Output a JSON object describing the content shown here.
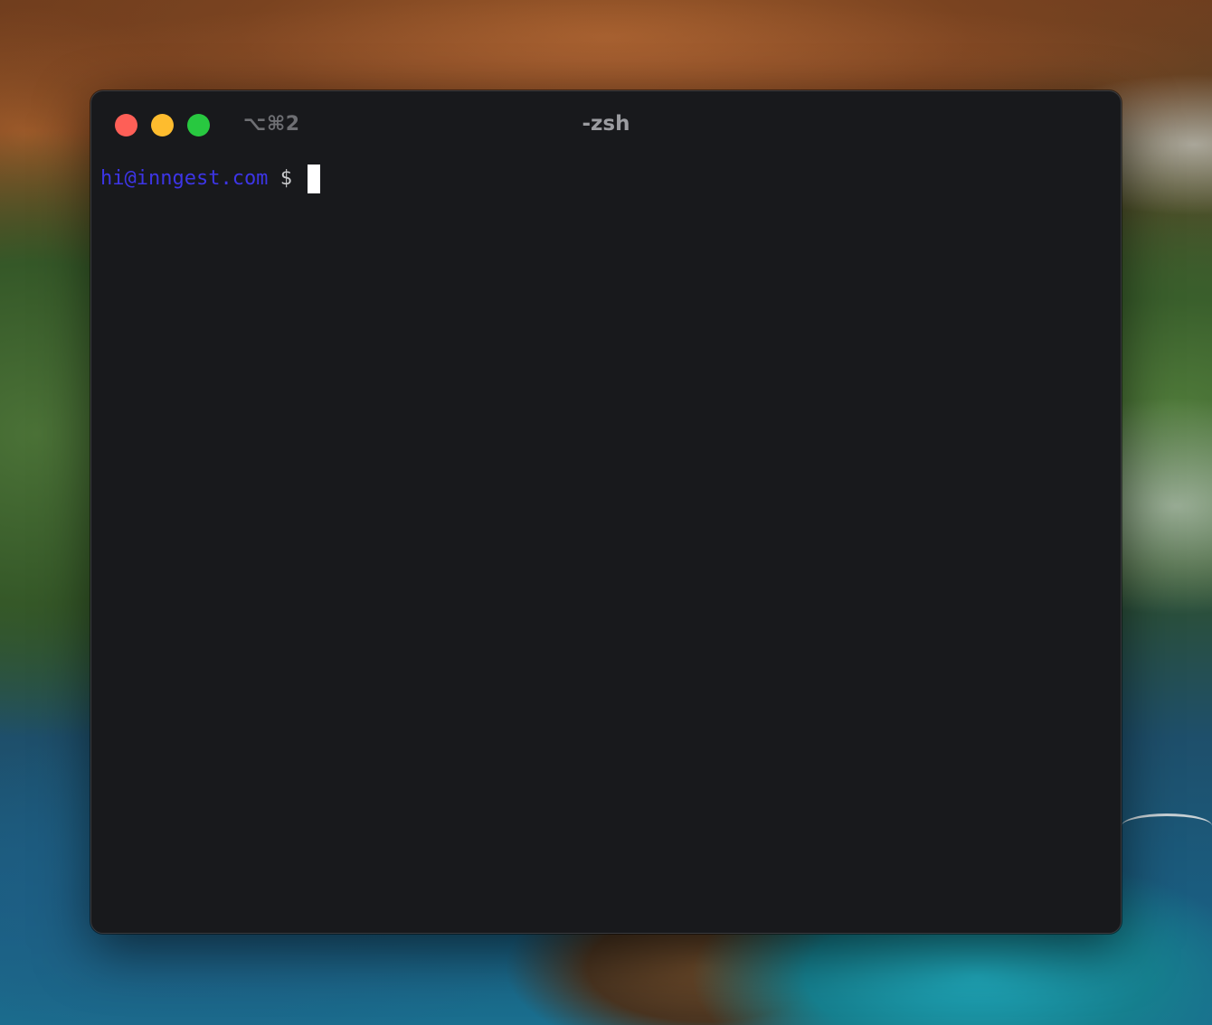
{
  "window": {
    "title": "-zsh",
    "shortcut": "⌥⌘2",
    "buttons": {
      "close_color": "#fe5f57",
      "minimize_color": "#febc2e",
      "zoom_color": "#28c840"
    }
  },
  "terminal": {
    "prompt_user": "hi@inngest.com",
    "prompt_symbol": "$",
    "input": "",
    "prompt_color": "#3d35e6",
    "background_color": "#18191c"
  },
  "desktop": {
    "wallpaper": "aerial coastline with mountains and ocean"
  }
}
